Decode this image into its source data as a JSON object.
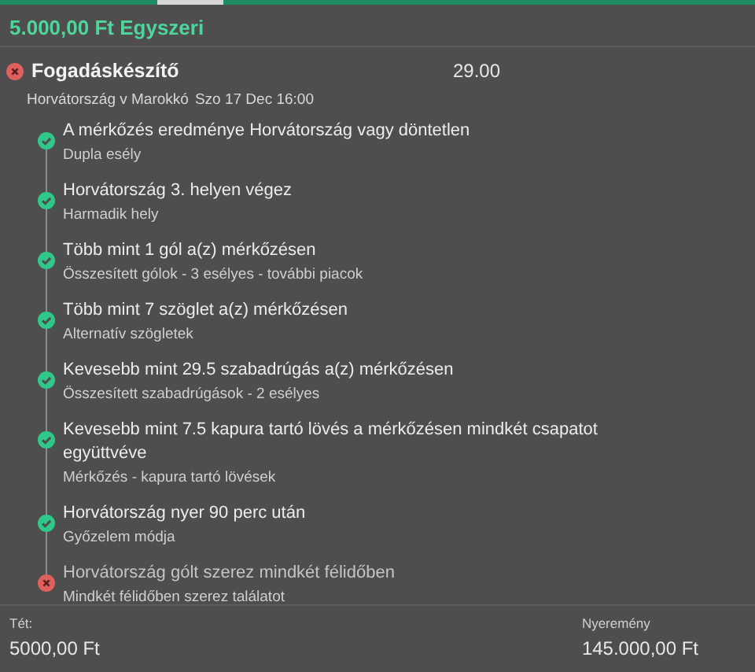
{
  "header": {
    "title": "5.000,00 Ft Egyszeri"
  },
  "bet": {
    "title": "Fogadáskészítő",
    "won": false,
    "odds": "29.00",
    "event": "Horvátország v Marokkó",
    "date": "Szo 17 Dec 16:00"
  },
  "selections": [
    {
      "title": "A mérkőzés eredménye Horvátország vagy döntetlen",
      "market": "Dupla esély",
      "won": true
    },
    {
      "title": "Horvátország 3. helyen végez",
      "market": "Harmadik hely",
      "won": true
    },
    {
      "title": "Több mint 1 gól a(z) mérkőzésen",
      "market": "Összesített gólok - 3 esélyes - további piacok",
      "won": true
    },
    {
      "title": "Több mint 7 szöglet a(z) mérkőzésen",
      "market": "Alternatív szögletek",
      "won": true
    },
    {
      "title": "Kevesebb mint 29.5 szabadrúgás a(z) mérkőzésen",
      "market": "Összesített szabadrúgások - 2 esélyes",
      "won": true
    },
    {
      "title": "Kevesebb mint 7.5 kapura tartó lövés a mérkőzésen mindkét csapatot együttvéve",
      "market": "Mérkőzés - kapura tartó lövések",
      "won": true
    },
    {
      "title": "Horvátország nyer 90 perc után",
      "market": "Győzelem módja",
      "won": true
    },
    {
      "title": "Horvátország gólt szerez mindkét félidőben",
      "market": "Mindkét félidőben szerez találatot",
      "won": false
    }
  ],
  "footer": {
    "stake_label": "Tét:",
    "stake": "5000,00 Ft",
    "returns_label": "Nyeremény",
    "returns": "145.000,00 Ft"
  }
}
